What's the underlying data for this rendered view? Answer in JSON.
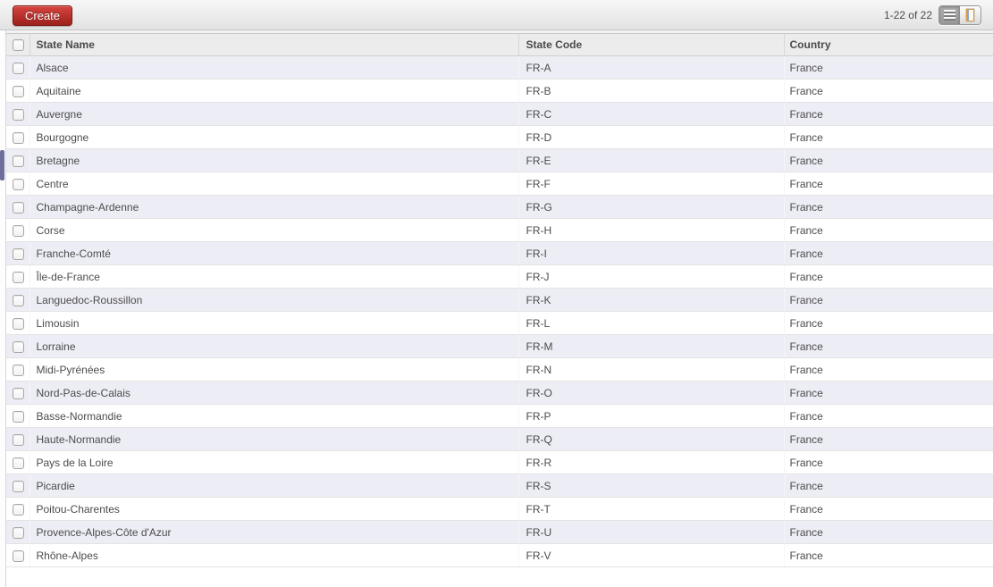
{
  "toolbar": {
    "create_label": "Create",
    "pager_text": "1-22 of 22",
    "view_switcher": {
      "active_view": "list",
      "icons": [
        "list-view-icon",
        "form-view-icon"
      ]
    }
  },
  "colors": {
    "accent-red": "#c03a34",
    "row-stripe": "#ededf6",
    "thumb": "#6e6e9d"
  },
  "table": {
    "columns": [
      "State Name",
      "State Code",
      "Country"
    ],
    "rows": [
      {
        "name": "Alsace",
        "code": "FR-A",
        "country": "France"
      },
      {
        "name": "Aquitaine",
        "code": "FR-B",
        "country": "France"
      },
      {
        "name": "Auvergne",
        "code": "FR-C",
        "country": "France"
      },
      {
        "name": "Bourgogne",
        "code": "FR-D",
        "country": "France"
      },
      {
        "name": "Bretagne",
        "code": "FR-E",
        "country": "France"
      },
      {
        "name": "Centre",
        "code": "FR-F",
        "country": "France"
      },
      {
        "name": "Champagne-Ardenne",
        "code": "FR-G",
        "country": "France"
      },
      {
        "name": "Corse",
        "code": "FR-H",
        "country": "France"
      },
      {
        "name": "Franche-Comté",
        "code": "FR-I",
        "country": "France"
      },
      {
        "name": "Île-de-France",
        "code": "FR-J",
        "country": "France"
      },
      {
        "name": "Languedoc-Roussillon",
        "code": "FR-K",
        "country": "France"
      },
      {
        "name": "Limousin",
        "code": "FR-L",
        "country": "France"
      },
      {
        "name": "Lorraine",
        "code": "FR-M",
        "country": "France"
      },
      {
        "name": "Midi-Pyrénées",
        "code": "FR-N",
        "country": "France"
      },
      {
        "name": "Nord-Pas-de-Calais",
        "code": "FR-O",
        "country": "France"
      },
      {
        "name": "Basse-Normandie",
        "code": "FR-P",
        "country": "France"
      },
      {
        "name": "Haute-Normandie",
        "code": "FR-Q",
        "country": "France"
      },
      {
        "name": "Pays de la Loire",
        "code": "FR-R",
        "country": "France"
      },
      {
        "name": "Picardie",
        "code": "FR-S",
        "country": "France"
      },
      {
        "name": "Poitou-Charentes",
        "code": "FR-T",
        "country": "France"
      },
      {
        "name": "Provence-Alpes-Côte d'Azur",
        "code": "FR-U",
        "country": "France"
      },
      {
        "name": "Rhône-Alpes",
        "code": "FR-V",
        "country": "France"
      }
    ]
  }
}
